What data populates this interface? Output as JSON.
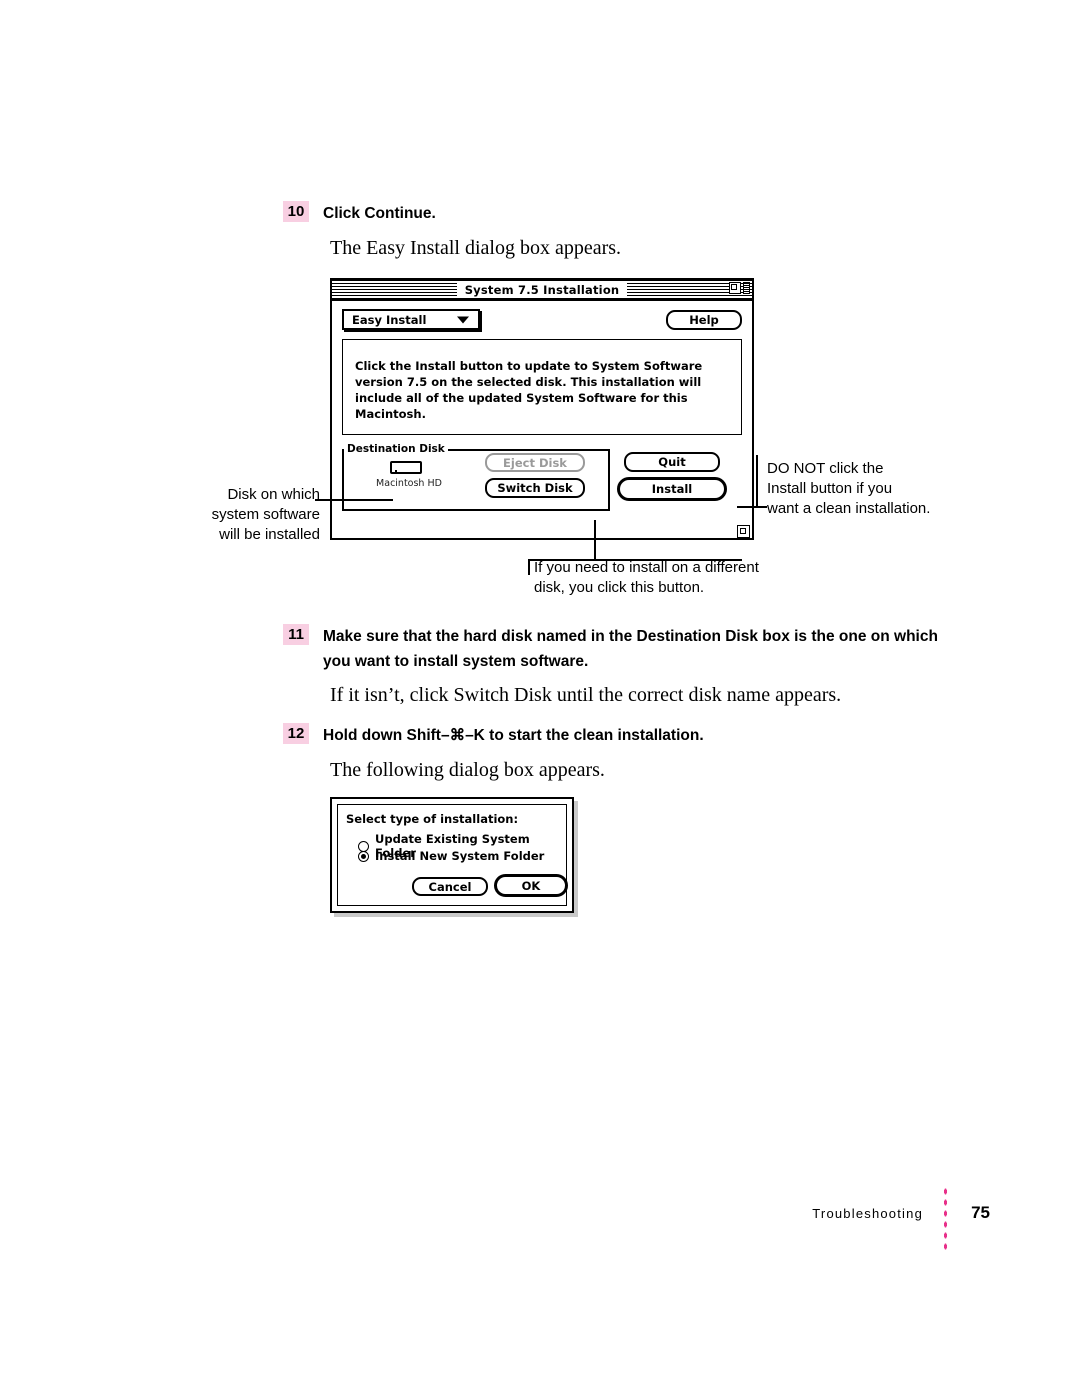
{
  "steps": {
    "step10": {
      "number": "10",
      "text": "Click Continue."
    },
    "step10_body": "The Easy Install dialog box appears.",
    "step11": {
      "number": "11",
      "text": "Make sure that the hard disk named in the Destination Disk box is the one on which you want to install system software."
    },
    "step11_body": "If it isn’t, click Switch Disk until the correct disk name appears.",
    "step12": {
      "number": "12",
      "text": "Hold down Shift–⌘–K to start the clean installation."
    },
    "step12_body": "The following dialog box appears."
  },
  "installer_window": {
    "title": "System 7.5 Installation",
    "popup_label": "Easy Install",
    "help_label": "Help",
    "message": "Click the Install button to update to System Software version 7.5 on the selected disk.  This installation will include all of the updated System Software for this Macintosh.",
    "group_label": "Destination Disk",
    "disk_name": "Macintosh HD",
    "eject_label": "Eject Disk",
    "switch_label": "Switch Disk",
    "quit_label": "Quit",
    "install_label": "Install"
  },
  "callouts": {
    "left": "Disk on which system software will be installed",
    "left_lines": [
      "Disk on which",
      "system software",
      "will be installed"
    ],
    "right_lines": [
      "DO NOT click the",
      "Install button if you",
      "want a clean installation."
    ],
    "bottom_lines": [
      "If you need to install on a different",
      "disk, you click this button."
    ]
  },
  "clean_install_dialog": {
    "title": "Select type of installation:",
    "option_update": "Update Existing System Folder",
    "option_install_new": "Install New System Folder",
    "cancel_label": "Cancel",
    "ok_label": "OK"
  },
  "footer": {
    "chapter": "Troubleshooting",
    "page": "75"
  },
  "colors": {
    "step_badge": "#f8cfe2",
    "footer_dots": "#e8308a"
  }
}
